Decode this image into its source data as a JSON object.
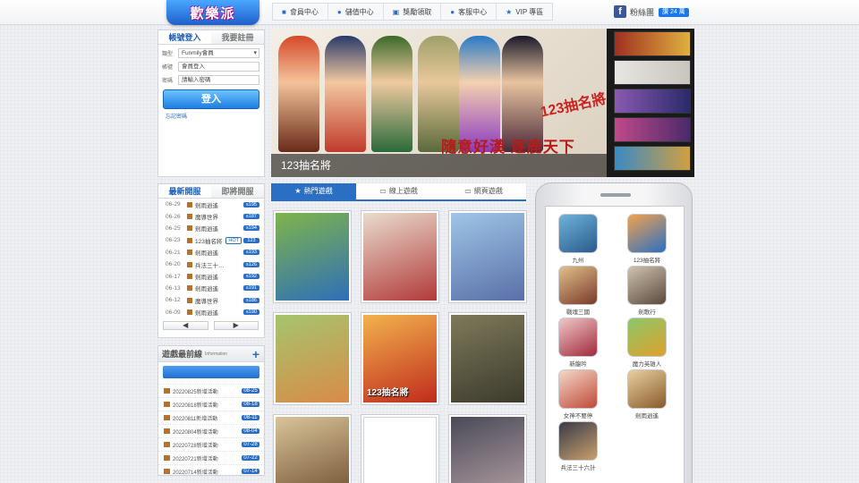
{
  "logo": {
    "text": "歡樂派"
  },
  "nav": [
    {
      "label": "會員中心",
      "icon": "user-icon",
      "glyph": "👤"
    },
    {
      "label": "儲值中心",
      "icon": "coin-icon",
      "glyph": "●"
    },
    {
      "label": "獎勵領取",
      "icon": "gift-icon",
      "glyph": "▣"
    },
    {
      "label": "客服中心",
      "icon": "chat-icon",
      "glyph": "●"
    },
    {
      "label": "VIP 專區",
      "icon": "star-icon",
      "glyph": "★"
    }
  ],
  "facebook": {
    "label": "粉絲團",
    "like": "讚 24 萬"
  },
  "login": {
    "tab_login": "帳號登入",
    "tab_register": "我要註冊",
    "type_label": "類型",
    "type_value": "Funmily會員",
    "account_label": "帳號",
    "account_placeholder": "會員登入",
    "password_label": "密碼",
    "password_placeholder": "請輸入密碼",
    "submit": "登入",
    "forgot": "忘記密碼"
  },
  "banner": {
    "caption": "123抽名將",
    "promo": "123抽名將",
    "slogan": "隨意好漢 逐鹿天下"
  },
  "news": {
    "tab_latest": "最新開服",
    "tab_upcoming": "即將開服",
    "rows": [
      {
        "date": "06-29",
        "title": "劍雨逍遙",
        "hot": "",
        "server": "s195"
      },
      {
        "date": "06-26",
        "title": "魔導世界",
        "hot": "",
        "server": "s187"
      },
      {
        "date": "06-25",
        "title": "劍雨逍遙",
        "hot": "",
        "server": "s194"
      },
      {
        "date": "06-23",
        "title": "123抽名將",
        "hot": "HOT",
        "server": "123"
      },
      {
        "date": "06-21",
        "title": "劍雨逍遙",
        "hot": "",
        "server": "s193"
      },
      {
        "date": "06-20",
        "title": "兵法三十…",
        "hot": "",
        "server": "s126"
      },
      {
        "date": "06-17",
        "title": "劍雨逍遙",
        "hot": "",
        "server": "s192"
      },
      {
        "date": "06-13",
        "title": "劍雨逍遙",
        "hot": "",
        "server": "s191"
      },
      {
        "date": "06-12",
        "title": "魔導世界",
        "hot": "",
        "server": "s186"
      },
      {
        "date": "06-09",
        "title": "劍雨逍遙",
        "hot": "",
        "server": "s190"
      }
    ],
    "prev": "◀",
    "next": "▶"
  },
  "info": {
    "title": "遊戲最前線",
    "subtitle": "Information",
    "plus": "+",
    "rows": [
      {
        "title": "20220825新增活動",
        "date": "08-25"
      },
      {
        "title": "20220818新增活動",
        "date": "08-18"
      },
      {
        "title": "20220811新增活動",
        "date": "08-11"
      },
      {
        "title": "20220804新增活動",
        "date": "08-04"
      },
      {
        "title": "20220728新增活動",
        "date": "07-28"
      },
      {
        "title": "20220721新增活動",
        "date": "07-22"
      },
      {
        "title": "20220714新增活動",
        "date": "07-14"
      }
    ]
  },
  "game_tabs": [
    {
      "label": "熱門遊戲",
      "icon": "star-icon",
      "glyph": "★"
    },
    {
      "label": "線上遊戲",
      "icon": "monitor-icon",
      "glyph": "▭"
    },
    {
      "label": "網頁遊戲",
      "icon": "laptop-icon",
      "glyph": "▭"
    }
  ],
  "game_cards": [
    {
      "title": "",
      "colors": [
        "#7fb44a",
        "#2e6fb8"
      ]
    },
    {
      "title": "",
      "colors": [
        "#e9dccd",
        "#b23a3a"
      ]
    },
    {
      "title": "",
      "colors": [
        "#9ec6e6",
        "#5a6fa8"
      ]
    },
    {
      "title": "",
      "colors": [
        "#a5c56e",
        "#d98b48"
      ]
    },
    {
      "title": "123抽名將",
      "colors": [
        "#f2b24d",
        "#c02c1c"
      ]
    },
    {
      "title": "",
      "colors": [
        "#7d7a5a",
        "#3c3a2c"
      ]
    },
    {
      "title": "",
      "colors": [
        "#d9c49a",
        "#6a4a2a"
      ]
    },
    {
      "title": "",
      "colors": [
        "#ffffff",
        "#ffffff"
      ]
    },
    {
      "title": "",
      "colors": [
        "#4a4a58",
        "#b9a4a8"
      ]
    }
  ],
  "apps": [
    {
      "name": "九州",
      "colors": [
        "#6fb3d8",
        "#2a5a8c"
      ]
    },
    {
      "name": "123抽名將",
      "colors": [
        "#f2a24d",
        "#2a6fc4"
      ]
    },
    {
      "name": "戰魂三國",
      "colors": [
        "#e0c08a",
        "#7a3a2a"
      ]
    },
    {
      "name": "劍歌行",
      "colors": [
        "#cfc2b0",
        "#5a4a3c"
      ]
    },
    {
      "name": "新龍吟",
      "colors": [
        "#f0c8c8",
        "#a02a3a"
      ]
    },
    {
      "name": "魔力英雄人",
      "colors": [
        "#8ac86a",
        "#e0a02a"
      ]
    },
    {
      "name": "女神不要停",
      "colors": [
        "#f4d8c8",
        "#c04a3a"
      ]
    },
    {
      "name": "劍雨逍遙",
      "colors": [
        "#e8d0a0",
        "#8a5a2a"
      ]
    },
    {
      "name": "兵法三十六計",
      "colors": [
        "#3a3a4a",
        "#c8a06a"
      ]
    }
  ]
}
